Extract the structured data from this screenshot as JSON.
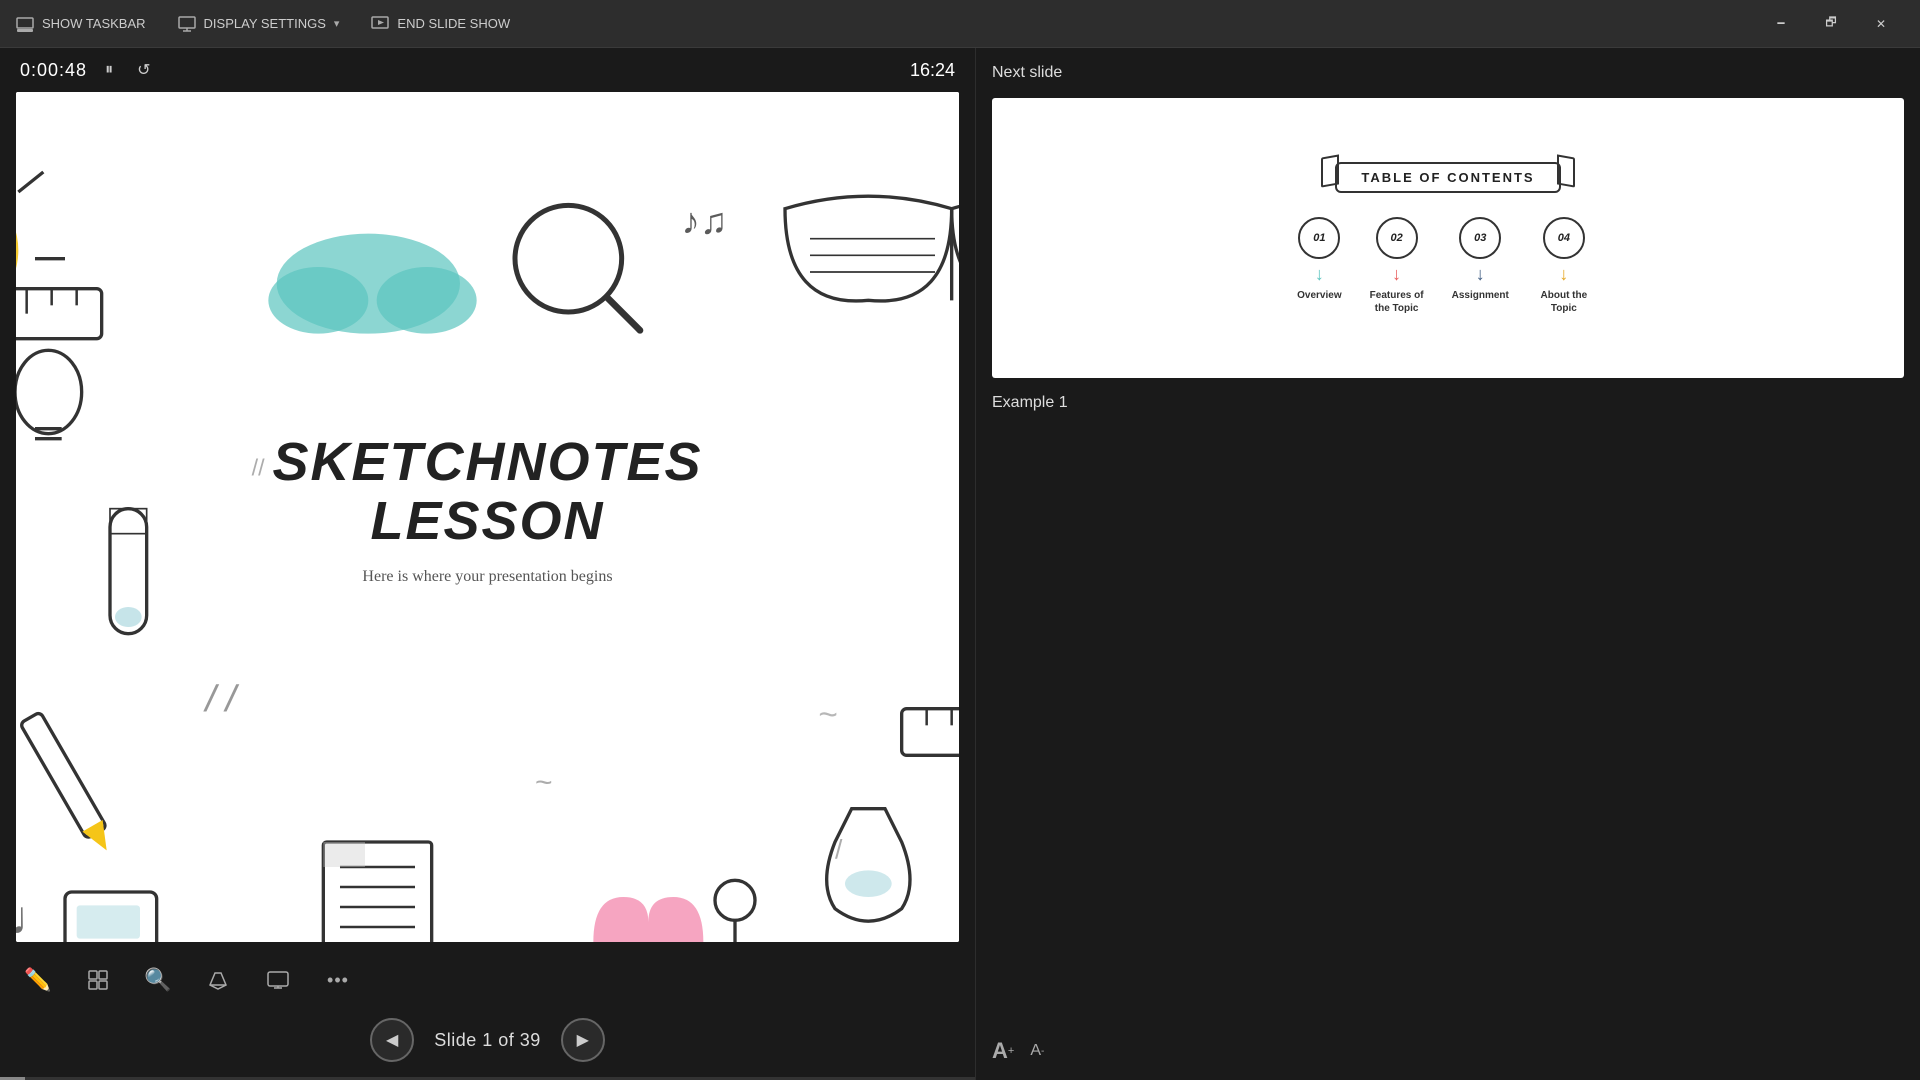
{
  "toolbar": {
    "show_taskbar": "SHOW TASKBAR",
    "display_settings": "DISPLAY SETTINGS",
    "display_settings_arrow": "▾",
    "end_slide_show": "END SLIDE SHOW",
    "window_minimize": "🗕",
    "window_restore": "🗗",
    "window_close": "✕"
  },
  "timer": {
    "elapsed": "0:00:48",
    "pause_icon": "⏸",
    "reset_icon": "↺",
    "clock": "16:24"
  },
  "slide": {
    "title": "SKETCHNOTES",
    "title_line2": "LESSON",
    "subtitle": "Here is where your presentation begins"
  },
  "tools": [
    {
      "name": "pen-tool",
      "icon": "✏",
      "label": "Pen"
    },
    {
      "name": "slides-grid-tool",
      "icon": "⊞",
      "label": "Grid"
    },
    {
      "name": "search-tool",
      "icon": "🔍",
      "label": "Search"
    },
    {
      "name": "highlight-tool",
      "icon": "▱",
      "label": "Highlight"
    },
    {
      "name": "screen-tool",
      "icon": "▭",
      "label": "Screen"
    },
    {
      "name": "more-tool",
      "icon": "•••",
      "label": "More"
    }
  ],
  "navigation": {
    "prev_label": "◀",
    "next_label": "▶",
    "slide_text": "Slide 1 of 39",
    "current": 1,
    "total": 39
  },
  "right_panel": {
    "next_slide_label": "Next slide",
    "example_label": "Example 1",
    "toc_title": "TABLE OF CONTENTS",
    "toc_items": [
      {
        "number": "01",
        "label": "Overview",
        "arrow_color": "teal"
      },
      {
        "number": "02",
        "label": "Features of the Topic",
        "arrow_color": "coral"
      },
      {
        "number": "03",
        "label": "Assignment",
        "arrow_color": "navy"
      },
      {
        "number": "04",
        "label": "About the Topic",
        "arrow_color": "gold"
      }
    ],
    "font_increase": "A",
    "font_decrease": "A"
  },
  "colors": {
    "background": "#1a1a1a",
    "toolbar_bg": "#2d2d2d",
    "slide_bg": "#ffffff",
    "accent_teal": "#5bc4bf",
    "accent_coral": "#e85d5d",
    "accent_navy": "#3d5a80",
    "accent_gold": "#e5a623"
  }
}
